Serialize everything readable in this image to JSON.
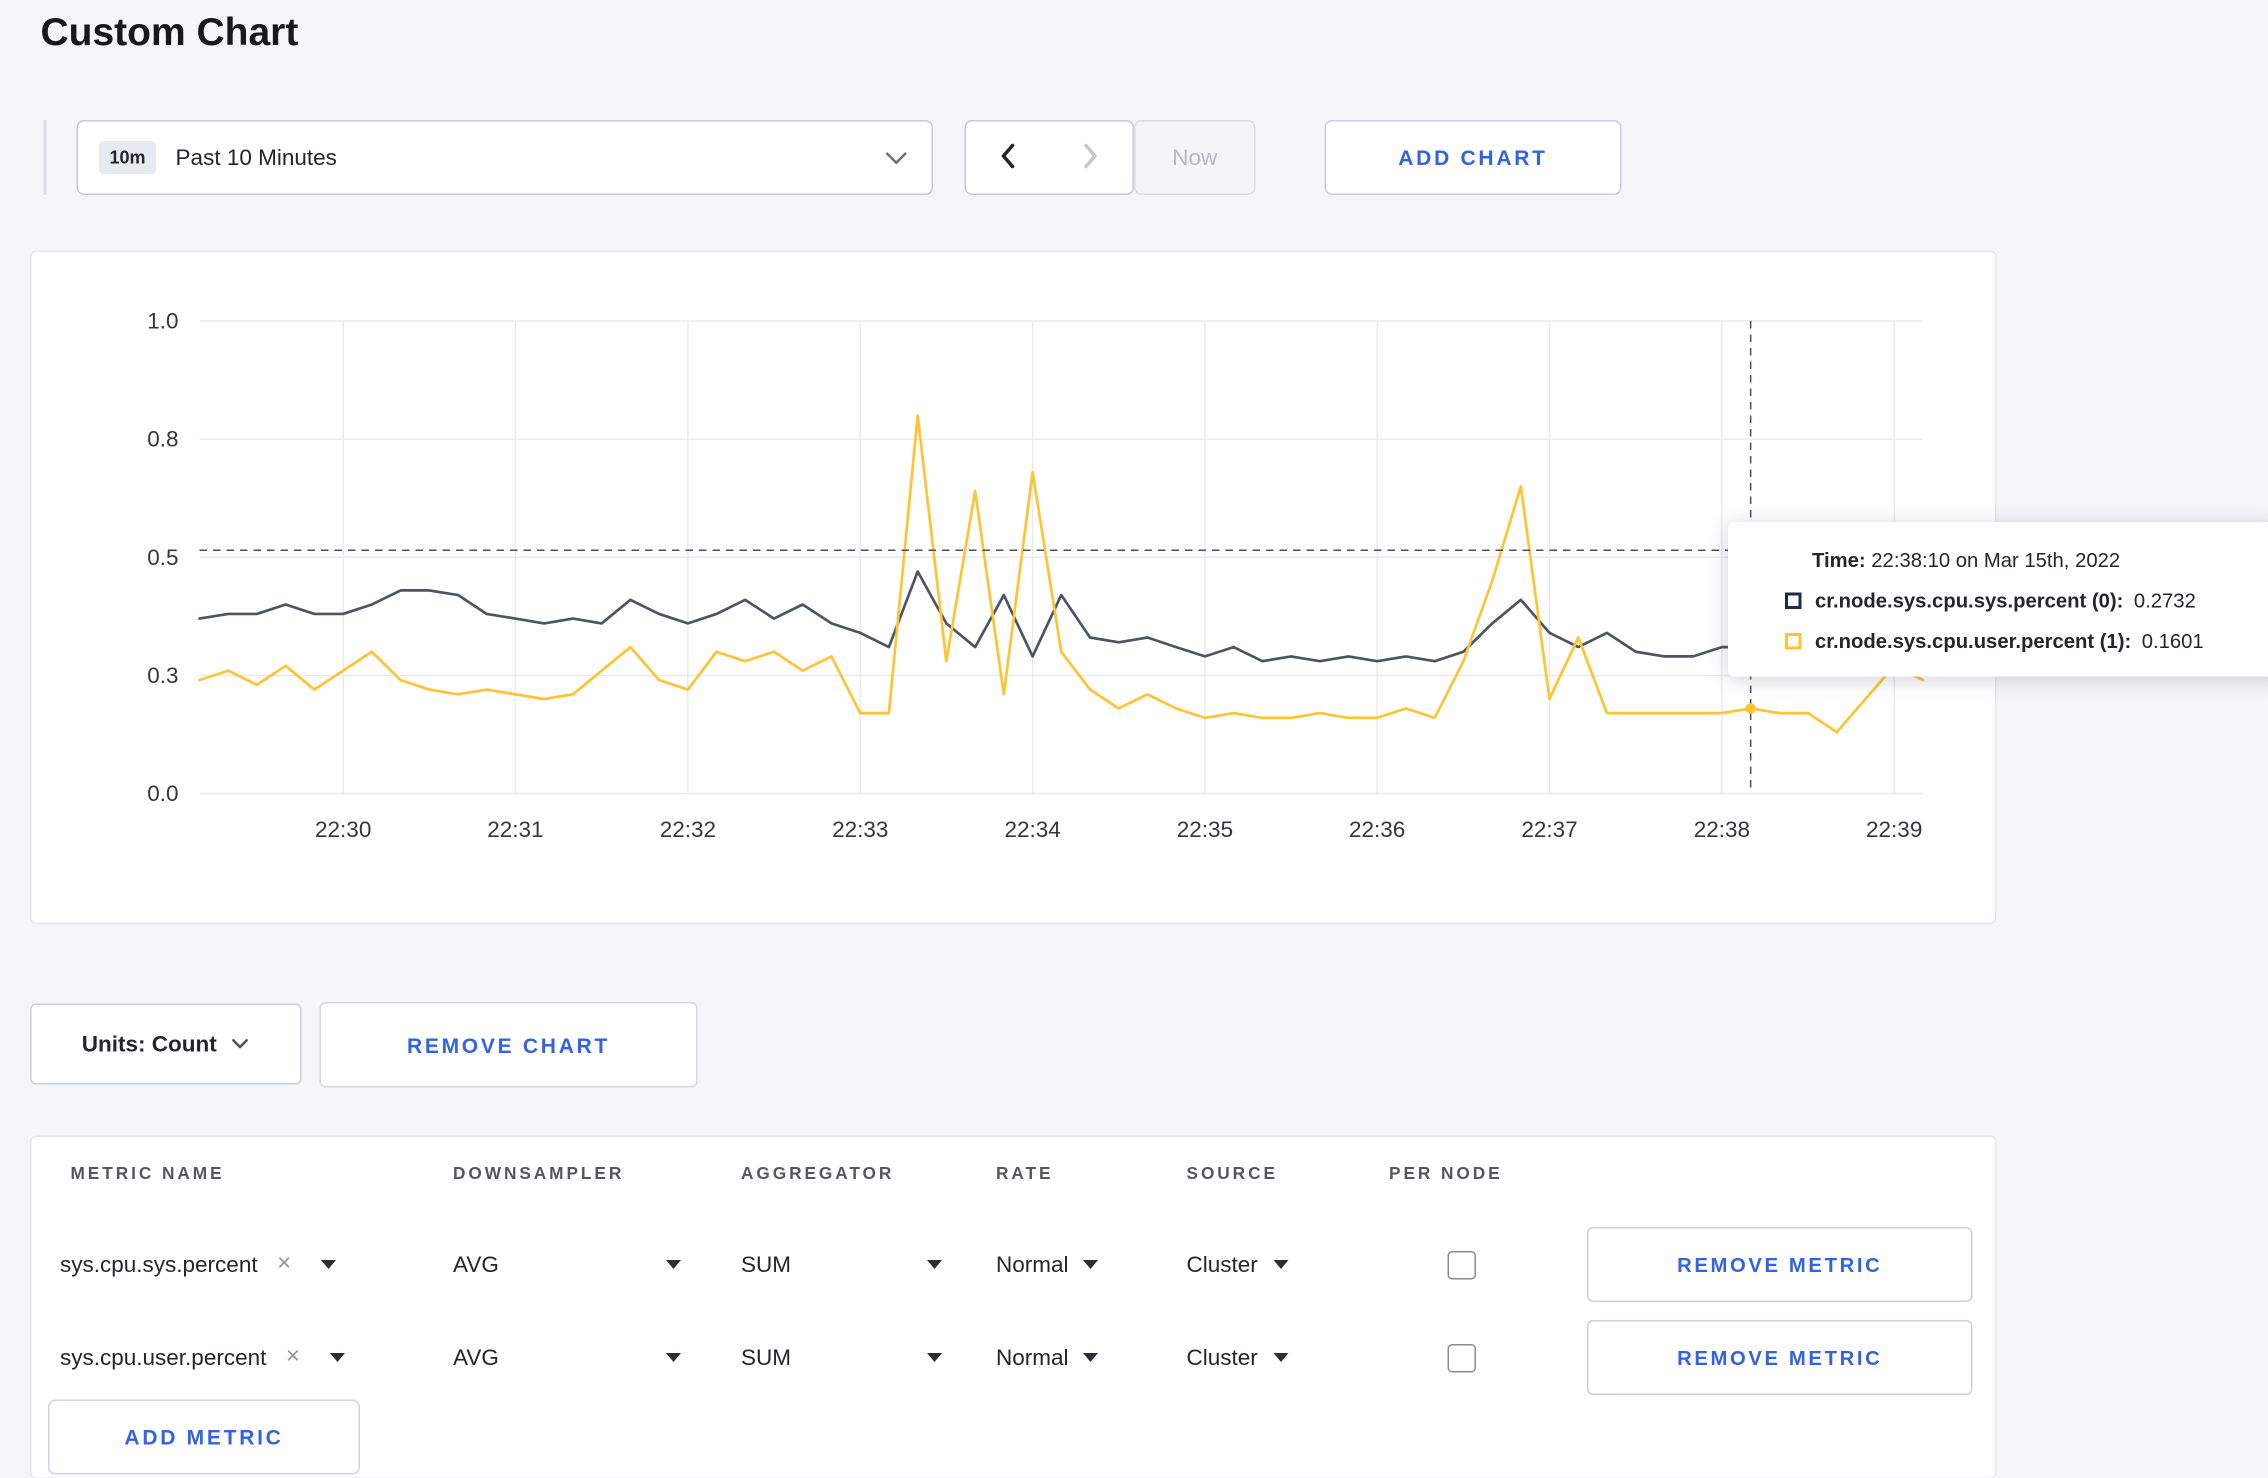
{
  "page": {
    "title": "Custom Chart"
  },
  "colors": {
    "accent": "#3263e2",
    "background": "#f5f6f9",
    "series_sys": "#4c5566",
    "series_user": "#ffc333"
  },
  "toolbar": {
    "range_badge": "10m",
    "range_label": "Past 10 Minutes",
    "now_label": "Now",
    "add_chart_label": "ADD CHART"
  },
  "chart_data": {
    "type": "line",
    "title": "",
    "x_start": "22:29:10",
    "x_step_seconds": 10,
    "x_tick_labels": [
      "22:30",
      "22:31",
      "22:32",
      "22:33",
      "22:34",
      "22:35",
      "22:36",
      "22:37",
      "22:38",
      "22:39"
    ],
    "tick_first_index": 5,
    "tick_step": 6,
    "y_ticks": [
      {
        "value": 0,
        "label": "0.0"
      },
      {
        "value": 0.25,
        "label": "0.3"
      },
      {
        "value": 0.5,
        "label": "0.5"
      },
      {
        "value": 0.75,
        "label": "0.8"
      },
      {
        "value": 1,
        "label": "1.0"
      }
    ],
    "ylim": [
      0,
      1
    ],
    "grid": true,
    "legend_position": "tooltip",
    "series": [
      {
        "name": "cr.node.sys.cpu.sys.percent",
        "color": "#4c5566",
        "values": [
          0.37,
          0.38,
          0.38,
          0.4,
          0.38,
          0.38,
          0.4,
          0.43,
          0.43,
          0.42,
          0.38,
          0.37,
          0.36,
          0.37,
          0.36,
          0.41,
          0.38,
          0.36,
          0.38,
          0.41,
          0.37,
          0.4,
          0.36,
          0.34,
          0.31,
          0.47,
          0.36,
          0.31,
          0.42,
          0.29,
          0.42,
          0.33,
          0.32,
          0.33,
          0.31,
          0.29,
          0.31,
          0.28,
          0.29,
          0.28,
          0.29,
          0.28,
          0.29,
          0.28,
          0.3,
          0.36,
          0.41,
          0.34,
          0.31,
          0.34,
          0.3,
          0.29,
          0.29,
          0.31,
          0.31,
          0.3,
          0.29,
          0.3,
          0.32,
          0.3,
          0.31
        ]
      },
      {
        "name": "cr.node.sys.cpu.user.percent",
        "color": "#ffc333",
        "values": [
          0.24,
          0.26,
          0.23,
          0.27,
          0.22,
          0.26,
          0.3,
          0.24,
          0.22,
          0.21,
          0.22,
          0.21,
          0.2,
          0.21,
          0.26,
          0.31,
          0.24,
          0.22,
          0.3,
          0.28,
          0.3,
          0.26,
          0.29,
          0.17,
          0.17,
          0.8,
          0.28,
          0.64,
          0.21,
          0.68,
          0.3,
          0.22,
          0.18,
          0.21,
          0.18,
          0.16,
          0.17,
          0.16,
          0.16,
          0.17,
          0.16,
          0.16,
          0.18,
          0.16,
          0.28,
          0.45,
          0.65,
          0.2,
          0.33,
          0.17,
          0.17,
          0.17,
          0.17,
          0.17,
          0.18,
          0.17,
          0.17,
          0.13,
          0.2,
          0.27,
          0.24
        ]
      }
    ],
    "crosshair": {
      "index": 54,
      "hline_value": 0.515,
      "time": "22:38:10"
    }
  },
  "tooltip": {
    "time_label": "Time:",
    "time_value": "22:38:10 on Mar 15th, 2022",
    "rows": [
      {
        "label": "cr.node.sys.cpu.sys.percent (0):",
        "value": "0.2732",
        "color": "#212b45"
      },
      {
        "label": "cr.node.sys.cpu.user.percent (1):",
        "value": "0.1601",
        "color": "#ffc333"
      }
    ]
  },
  "chart_controls": {
    "units_label": "Units: Count",
    "remove_chart_label": "REMOVE CHART"
  },
  "metrics_table": {
    "headers": [
      "METRIC NAME",
      "DOWNSAMPLER",
      "AGGREGATOR",
      "RATE",
      "SOURCE",
      "PER NODE"
    ],
    "clear_glyph": "×",
    "rows": [
      {
        "metric": "sys.cpu.sys.percent",
        "downsampler": "AVG",
        "aggregator": "SUM",
        "rate": "Normal",
        "source": "Cluster",
        "per_node": false,
        "remove_label": "REMOVE METRIC"
      },
      {
        "metric": "sys.cpu.user.percent",
        "downsampler": "AVG",
        "aggregator": "SUM",
        "rate": "Normal",
        "source": "Cluster",
        "per_node": false,
        "remove_label": "REMOVE METRIC"
      }
    ],
    "add_metric_label": "ADD METRIC"
  }
}
